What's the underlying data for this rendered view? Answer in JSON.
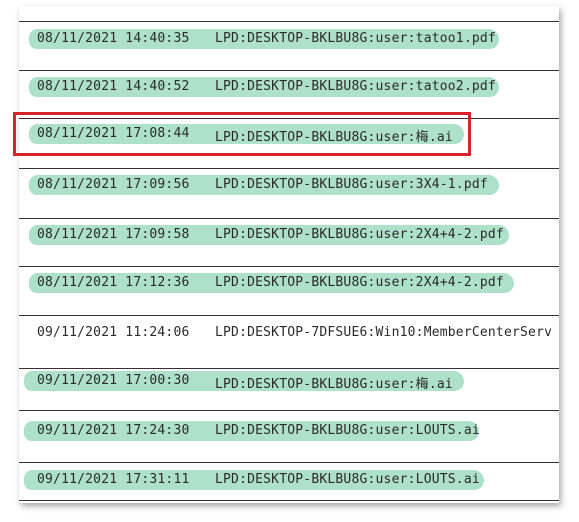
{
  "log_rows": [
    {
      "date": "08/11/2021 14:40:35",
      "path": "LPD:DESKTOP-BKLBU8G:user:tatoo1.pdf",
      "highlighted": true
    },
    {
      "date": "08/11/2021 14:40:52",
      "path": "LPD:DESKTOP-BKLBU8G:user:tatoo2.pdf",
      "highlighted": true
    },
    {
      "date": "08/11/2021 17:08:44",
      "path": "LPD:DESKTOP-BKLBU8G:user:梅.ai",
      "highlighted": true,
      "boxed": true
    },
    {
      "date": "08/11/2021 17:09:56",
      "path": "LPD:DESKTOP-BKLBU8G:user:3X4-1.pdf",
      "highlighted": true
    },
    {
      "date": "08/11/2021 17:09:58",
      "path": "LPD:DESKTOP-BKLBU8G:user:2X4+4-2.pdf",
      "highlighted": true
    },
    {
      "date": "08/11/2021 17:12:36",
      "path": "LPD:DESKTOP-BKLBU8G:user:2X4+4-2.pdf",
      "highlighted": true
    },
    {
      "date": "09/11/2021 11:24:06",
      "path": "LPD:DESKTOP-7DFSUE6:Win10:MemberCenterServ",
      "highlighted": false
    },
    {
      "date": "09/11/2021 17:00:30",
      "path": "LPD:DESKTOP-BKLBU8G:user:梅.ai",
      "highlighted": true
    },
    {
      "date": "09/11/2021 17:24:30",
      "path": "LPD:DESKTOP-BKLBU8G:user:LOUTS.ai",
      "highlighted": true
    },
    {
      "date": "09/11/2021 17:31:11",
      "path": "LPD:DESKTOP-BKLBU8G:user:LOUTS.ai",
      "highlighted": true
    }
  ],
  "colors": {
    "highlighter": "#9fdcbf",
    "callout_box": "#d9232a",
    "rule": "#333333",
    "text": "#2a2a2a"
  }
}
